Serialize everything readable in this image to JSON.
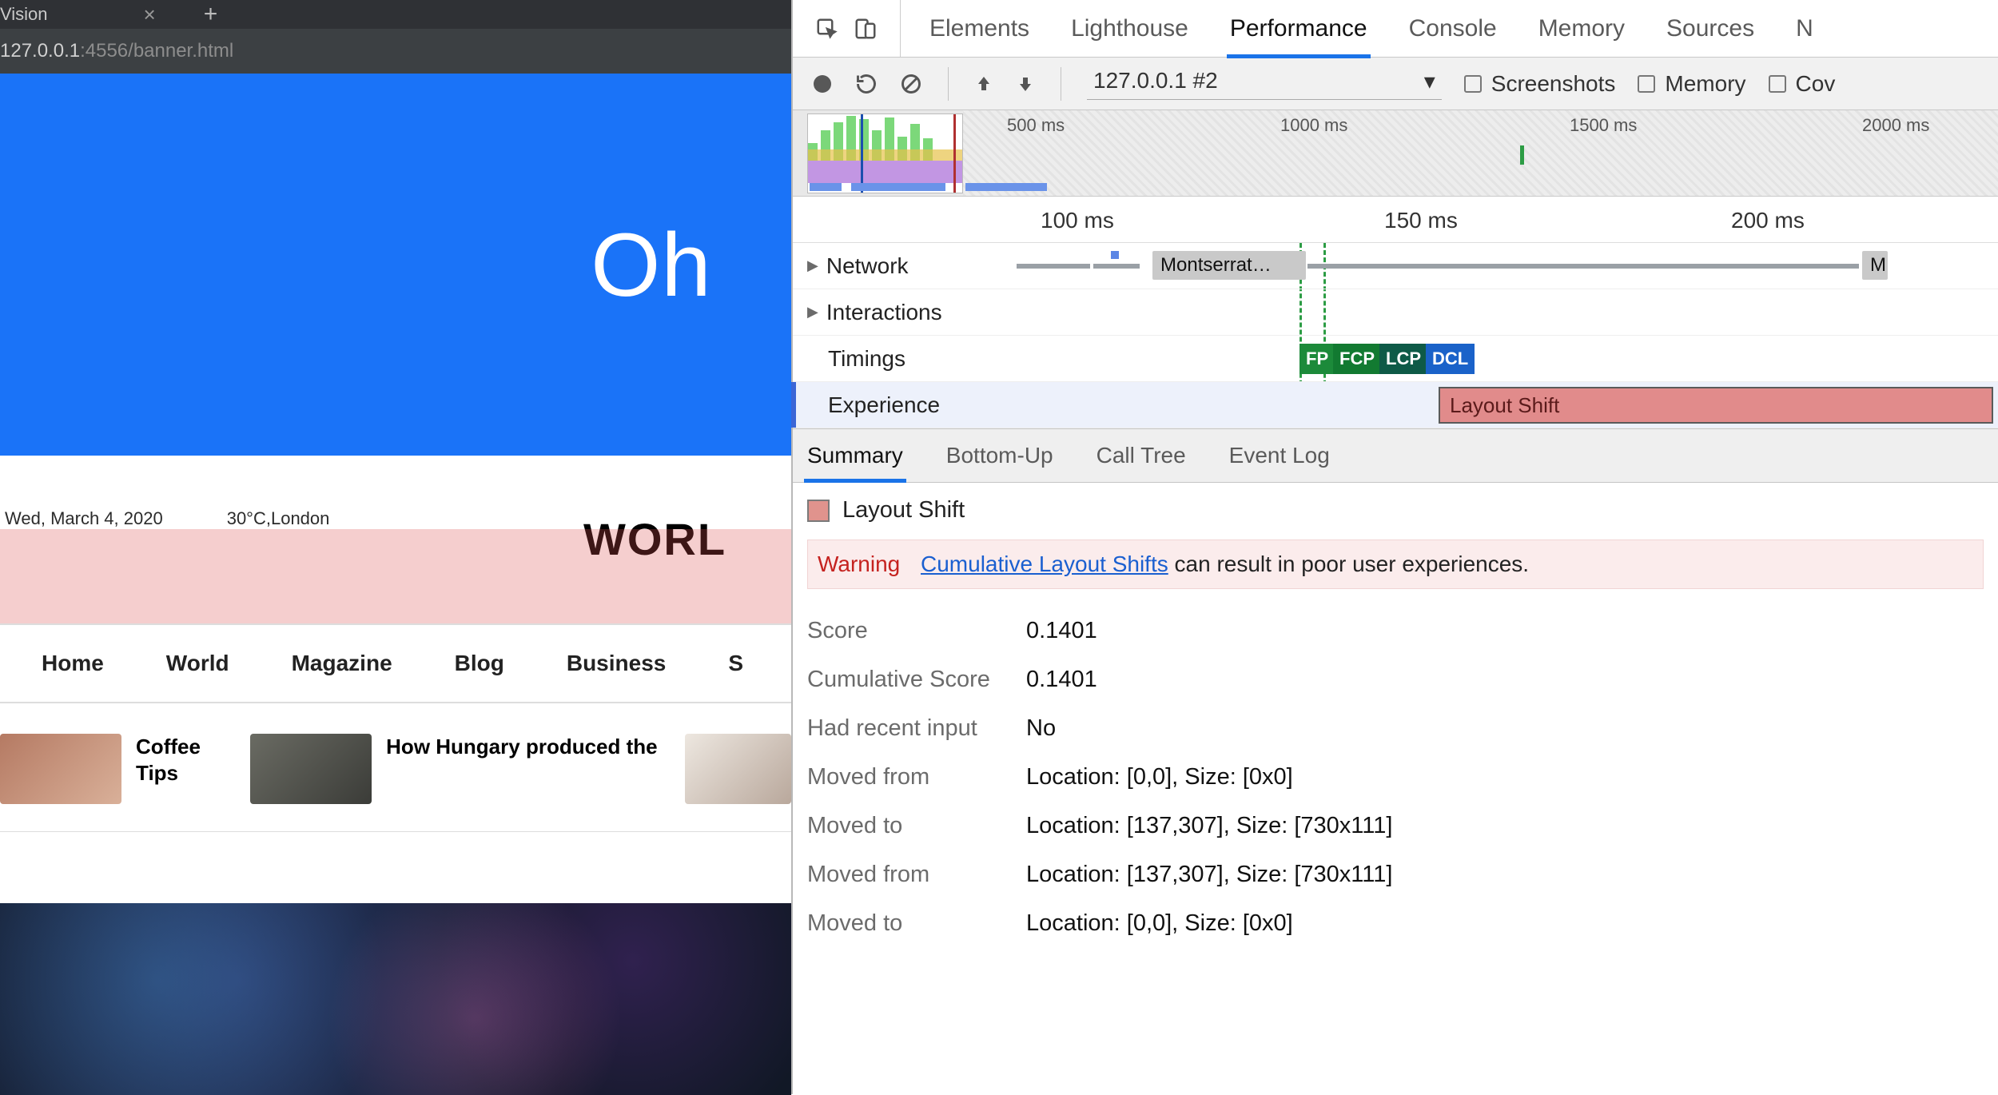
{
  "browser": {
    "tab_title": "Vision",
    "url_host": "127.0.0.1",
    "url_port_path": ":4556/banner.html",
    "banner_text": "Oh",
    "date": "Wed, March 4, 2020",
    "weather": "30°C,London",
    "site_title": "WORL",
    "nav": [
      "Home",
      "World",
      "Magazine",
      "Blog",
      "Business",
      "S"
    ],
    "ticker": [
      {
        "title": "Coffee Tips"
      },
      {
        "title": "How Hungary produced the"
      }
    ]
  },
  "devtools": {
    "tabs": [
      "Elements",
      "Lighthouse",
      "Performance",
      "Console",
      "Memory",
      "Sources",
      "N"
    ],
    "active_tab": "Performance",
    "toolbar": {
      "recording_select": "127.0.0.1 #2",
      "checkboxes": [
        "Screenshots",
        "Memory",
        "Cov"
      ]
    },
    "overview_ticks": [
      "500 ms",
      "1000 ms",
      "1500 ms",
      "2000 ms"
    ],
    "flame_ruler": [
      "100 ms",
      "150 ms",
      "200 ms"
    ],
    "tracks": {
      "network": "Network",
      "network_item": "Montserrat…",
      "network_item2": "M",
      "interactions": "Interactions",
      "timings": "Timings",
      "timing_markers": [
        "FP",
        "FCP",
        "LCP",
        "DCL"
      ],
      "experience": "Experience",
      "experience_item": "Layout Shift"
    },
    "subtabs": [
      "Summary",
      "Bottom-Up",
      "Call Tree",
      "Event Log"
    ],
    "active_subtab": "Summary",
    "detail": {
      "title": "Layout Shift",
      "warning_label": "Warning",
      "warning_link": "Cumulative Layout Shifts",
      "warning_rest": " can result in poor user experiences.",
      "rows": [
        {
          "k": "Score",
          "v": "0.1401"
        },
        {
          "k": "Cumulative Score",
          "v": "0.1401"
        },
        {
          "k": "Had recent input",
          "v": "No"
        },
        {
          "k": "Moved from",
          "v": "Location: [0,0], Size: [0x0]"
        },
        {
          "k": "Moved to",
          "v": "Location: [137,307], Size: [730x111]"
        },
        {
          "k": "Moved from",
          "v": "Location: [137,307], Size: [730x111]"
        },
        {
          "k": "Moved to",
          "v": "Location: [0,0], Size: [0x0]"
        }
      ]
    }
  }
}
